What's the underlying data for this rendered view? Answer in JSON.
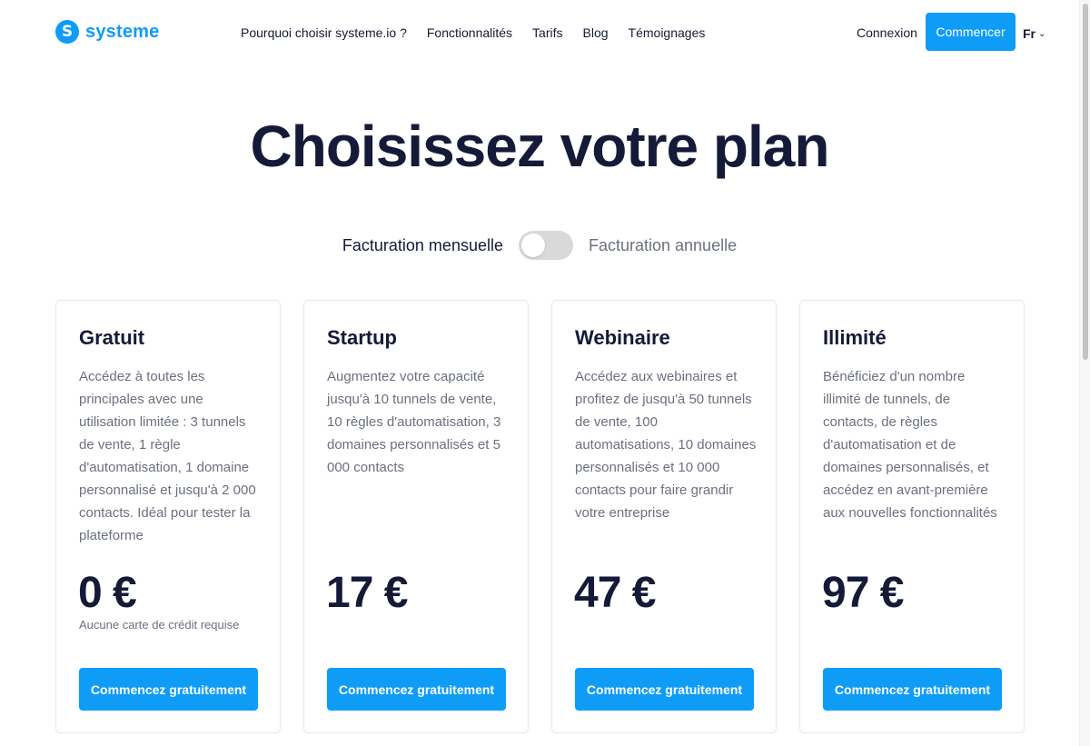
{
  "header": {
    "logo_letter": "S",
    "logo_text": "systeme",
    "nav": [
      {
        "label": "Pourquoi choisir systeme.io ?"
      },
      {
        "label": "Fonctionnalités"
      },
      {
        "label": "Tarifs"
      },
      {
        "label": "Blog"
      },
      {
        "label": "Témoignages"
      }
    ],
    "login_label": "Connexion",
    "start_label": "Commencer",
    "language": "Fr"
  },
  "title": "Choisissez votre plan",
  "billing": {
    "monthly_label": "Facturation mensuelle",
    "annual_label": "Facturation annuelle",
    "annual_selected": false
  },
  "plans": [
    {
      "name": "Gratuit",
      "description": "Accédez à toutes les principales avec une utilisation limitée : 3 tunnels de vente, 1 règle d'automatisation, 1 domaine personnalisé et jusqu'à 2 000 contacts. Idéal pour tester la plateforme",
      "price": "0 €",
      "note": "Aucune carte de crédit requise",
      "button_label": "Commencez gratuitement"
    },
    {
      "name": "Startup",
      "description": "Augmentez votre capacité jusqu'à 10 tunnels de vente, 10 règles d'automatisation, 3 domaines personnalisés et 5 000 contacts",
      "price": "17 €",
      "note": "",
      "button_label": "Commencez gratuitement"
    },
    {
      "name": "Webinaire",
      "description": "Accédez aux webinaires et profitez de jusqu'à 50 tunnels de vente, 100 automatisations, 10 domaines personnalisés et 10 000 contacts pour faire grandir votre entreprise",
      "price": "47 €",
      "note": "",
      "button_label": "Commencez gratuitement"
    },
    {
      "name": "Illimité",
      "description": "Bénéficiez d'un nombre illimité de tunnels, de contacts, de règles d'automatisation et de domaines personnalisés, et accédez en avant-première aux nouvelles fonctionnalités",
      "price": "97 €",
      "note": "",
      "button_label": "Commencez gratuitement"
    }
  ],
  "colors": {
    "accent": "#0e9cf7",
    "text": "#141a38",
    "muted": "#6b7080",
    "toggle_off": "#d9d9d9"
  }
}
